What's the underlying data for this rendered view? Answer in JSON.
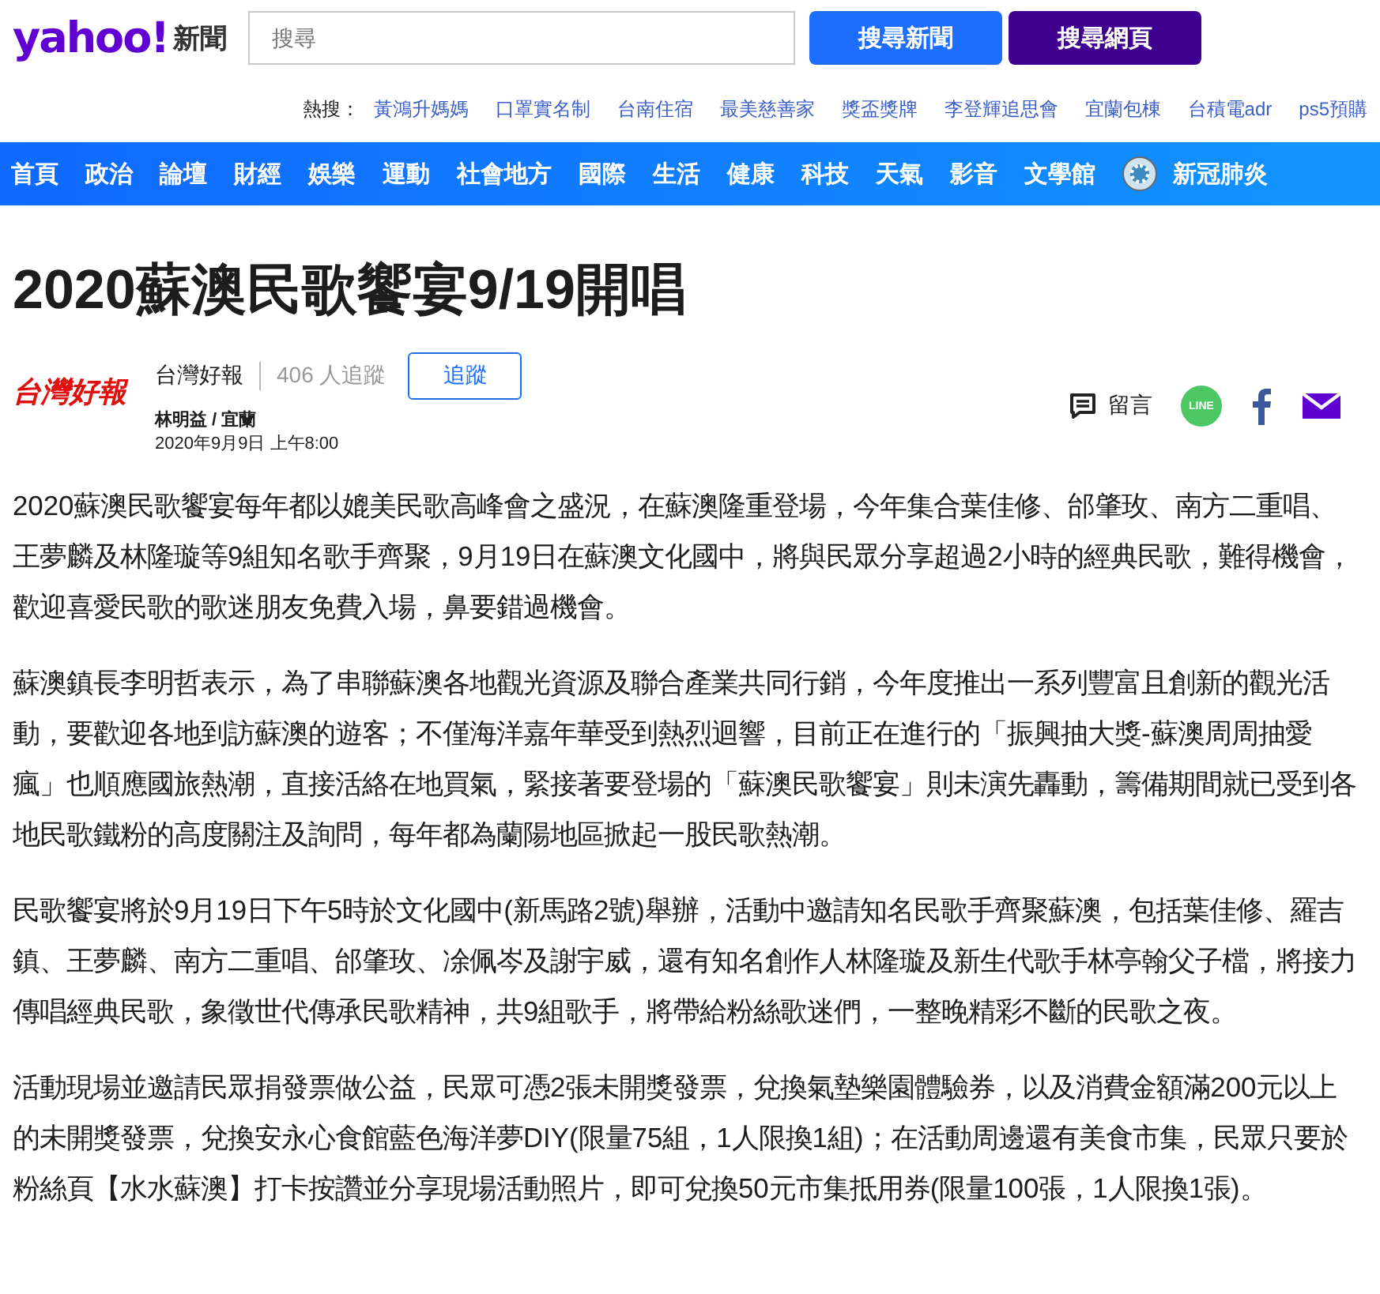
{
  "header": {
    "logo": "yahoo!",
    "logo_suffix": "新聞",
    "search": {
      "placeholder": "搜尋"
    },
    "buttons": [
      {
        "label": "搜尋新聞",
        "kind": "news"
      },
      {
        "label": "搜尋網頁",
        "kind": "web"
      }
    ]
  },
  "hot_searches": {
    "label": "熱搜：",
    "items": [
      "黃鴻升媽媽",
      "口罩實名制",
      "台南住宿",
      "最美慈善家",
      "獎盃獎牌",
      "李登輝追思會",
      "宜蘭包棟",
      "台積電adr",
      "ps5預購"
    ]
  },
  "nav": [
    {
      "label": "首頁"
    },
    {
      "label": "政治"
    },
    {
      "label": "論壇"
    },
    {
      "label": "財經"
    },
    {
      "label": "娛樂"
    },
    {
      "label": "運動"
    },
    {
      "label": "社會地方"
    },
    {
      "label": "國際"
    },
    {
      "label": "生活"
    },
    {
      "label": "健康"
    },
    {
      "label": "科技"
    },
    {
      "label": "天氣"
    },
    {
      "label": "影音"
    },
    {
      "label": "文學館"
    },
    {
      "label": "新冠肺炎",
      "kind": "icon"
    }
  ],
  "article": {
    "title": "2020蘇澳民歌饗宴9/19開唱",
    "source": {
      "logo": "台灣好報",
      "name": "台灣好報",
      "followers": "406 人追蹤",
      "follow_button": "追蹤",
      "author": "林明益 / 宜蘭",
      "date": "2020年9月9日 上午8:00"
    },
    "actions": {
      "comment": "留言",
      "line": "LINE"
    },
    "paragraphs": [
      "2020蘇澳民歌饗宴每年都以媲美民歌高峰會之盛況，在蘇澳隆重登場，今年集合葉佳修、邰肇玫、南方二重唱、王夢麟及林隆璇等9組知名歌手齊聚，9月19日在蘇澳文化國中，將與民眾分享超過2小時的經典民歌，難得機會，歡迎喜愛民歌的歌迷朋友免費入場，鼻要錯過機會。",
      "蘇澳鎮長李明哲表示，為了串聯蘇澳各地觀光資源及聯合產業共同行銷，今年度推出一系列豐富且創新的觀光活動，要歡迎各地到訪蘇澳的遊客；不僅海洋嘉年華受到熱烈迴響，目前正在進行的「振興抽大獎-蘇澳周周抽愛瘋」也順應國旅熱潮，直接活絡在地買氣，緊接著要登場的「蘇澳民歌饗宴」則未演先轟動，籌備期間就已受到各地民歌鐵粉的高度關注及詢問，每年都為蘭陽地區掀起一股民歌熱潮。",
      "民歌饗宴將於9月19日下午5時於文化國中(新馬路2號)舉辦，活動中邀請知名民歌手齊聚蘇澳，包括葉佳修、羅吉鎮、王夢麟、南方二重唱、邰肇玫、凃佩岑及謝宇威，還有知名創作人林隆璇及新生代歌手林亭翰父子檔，將接力傳唱經典民歌，象徵世代傳承民歌精神，共9組歌手，將帶給粉絲歌迷們，一整晚精彩不斷的民歌之夜。",
      "活動現場並邀請民眾捐發票做公益，民眾可憑2張未開獎發票，兌換氣墊樂園體驗券，以及消費金額滿200元以上的未開獎發票，兌換安永心食館藍色海洋夢DIY(限量75組，1人限換1組)；在活動周邊還有美食市集，民眾只要於粉絲頁【水水蘇澳】打卡按讚並分享現場活動照片，即可兌換50元市集抵用券(限量100張，1人限換1張)。"
    ]
  }
}
